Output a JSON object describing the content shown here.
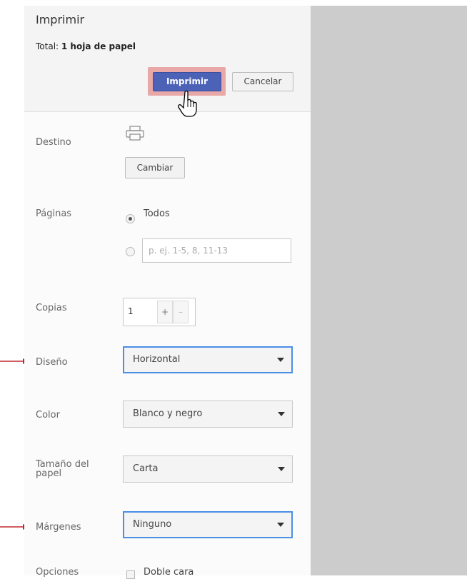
{
  "header": {
    "title": "Imprimir",
    "total_prefix": "Total:",
    "total_value": "1 hoja de papel",
    "print_label": "Imprimir",
    "cancel_label": "Cancelar"
  },
  "destination": {
    "label": "Destino",
    "icon": "printer-icon",
    "change_label": "Cambiar"
  },
  "pages": {
    "label": "Páginas",
    "all_label": "Todos",
    "all_selected": true,
    "range_placeholder": "p. ej. 1-5, 8, 11-13"
  },
  "copies": {
    "label": "Copias",
    "value": "1",
    "plus_label": "+",
    "minus_label": "–"
  },
  "layout": {
    "label": "Diseño",
    "value": "Horizontal"
  },
  "color": {
    "label": "Color",
    "value": "Blanco y negro"
  },
  "paper_size": {
    "label_line1": "Tamaño del",
    "label_line2": "papel",
    "value": "Carta"
  },
  "margins": {
    "label": "Márgenes",
    "value": "Ninguno"
  },
  "options": {
    "label": "Opciones",
    "duplex_label": "Doble cara"
  },
  "colors": {
    "accent": "#4b62b7",
    "highlight": "#e8a8a8",
    "focus": "#4a8fe6",
    "annotation_arrow": "#c0282b",
    "preview_bg": "#cccccc"
  }
}
